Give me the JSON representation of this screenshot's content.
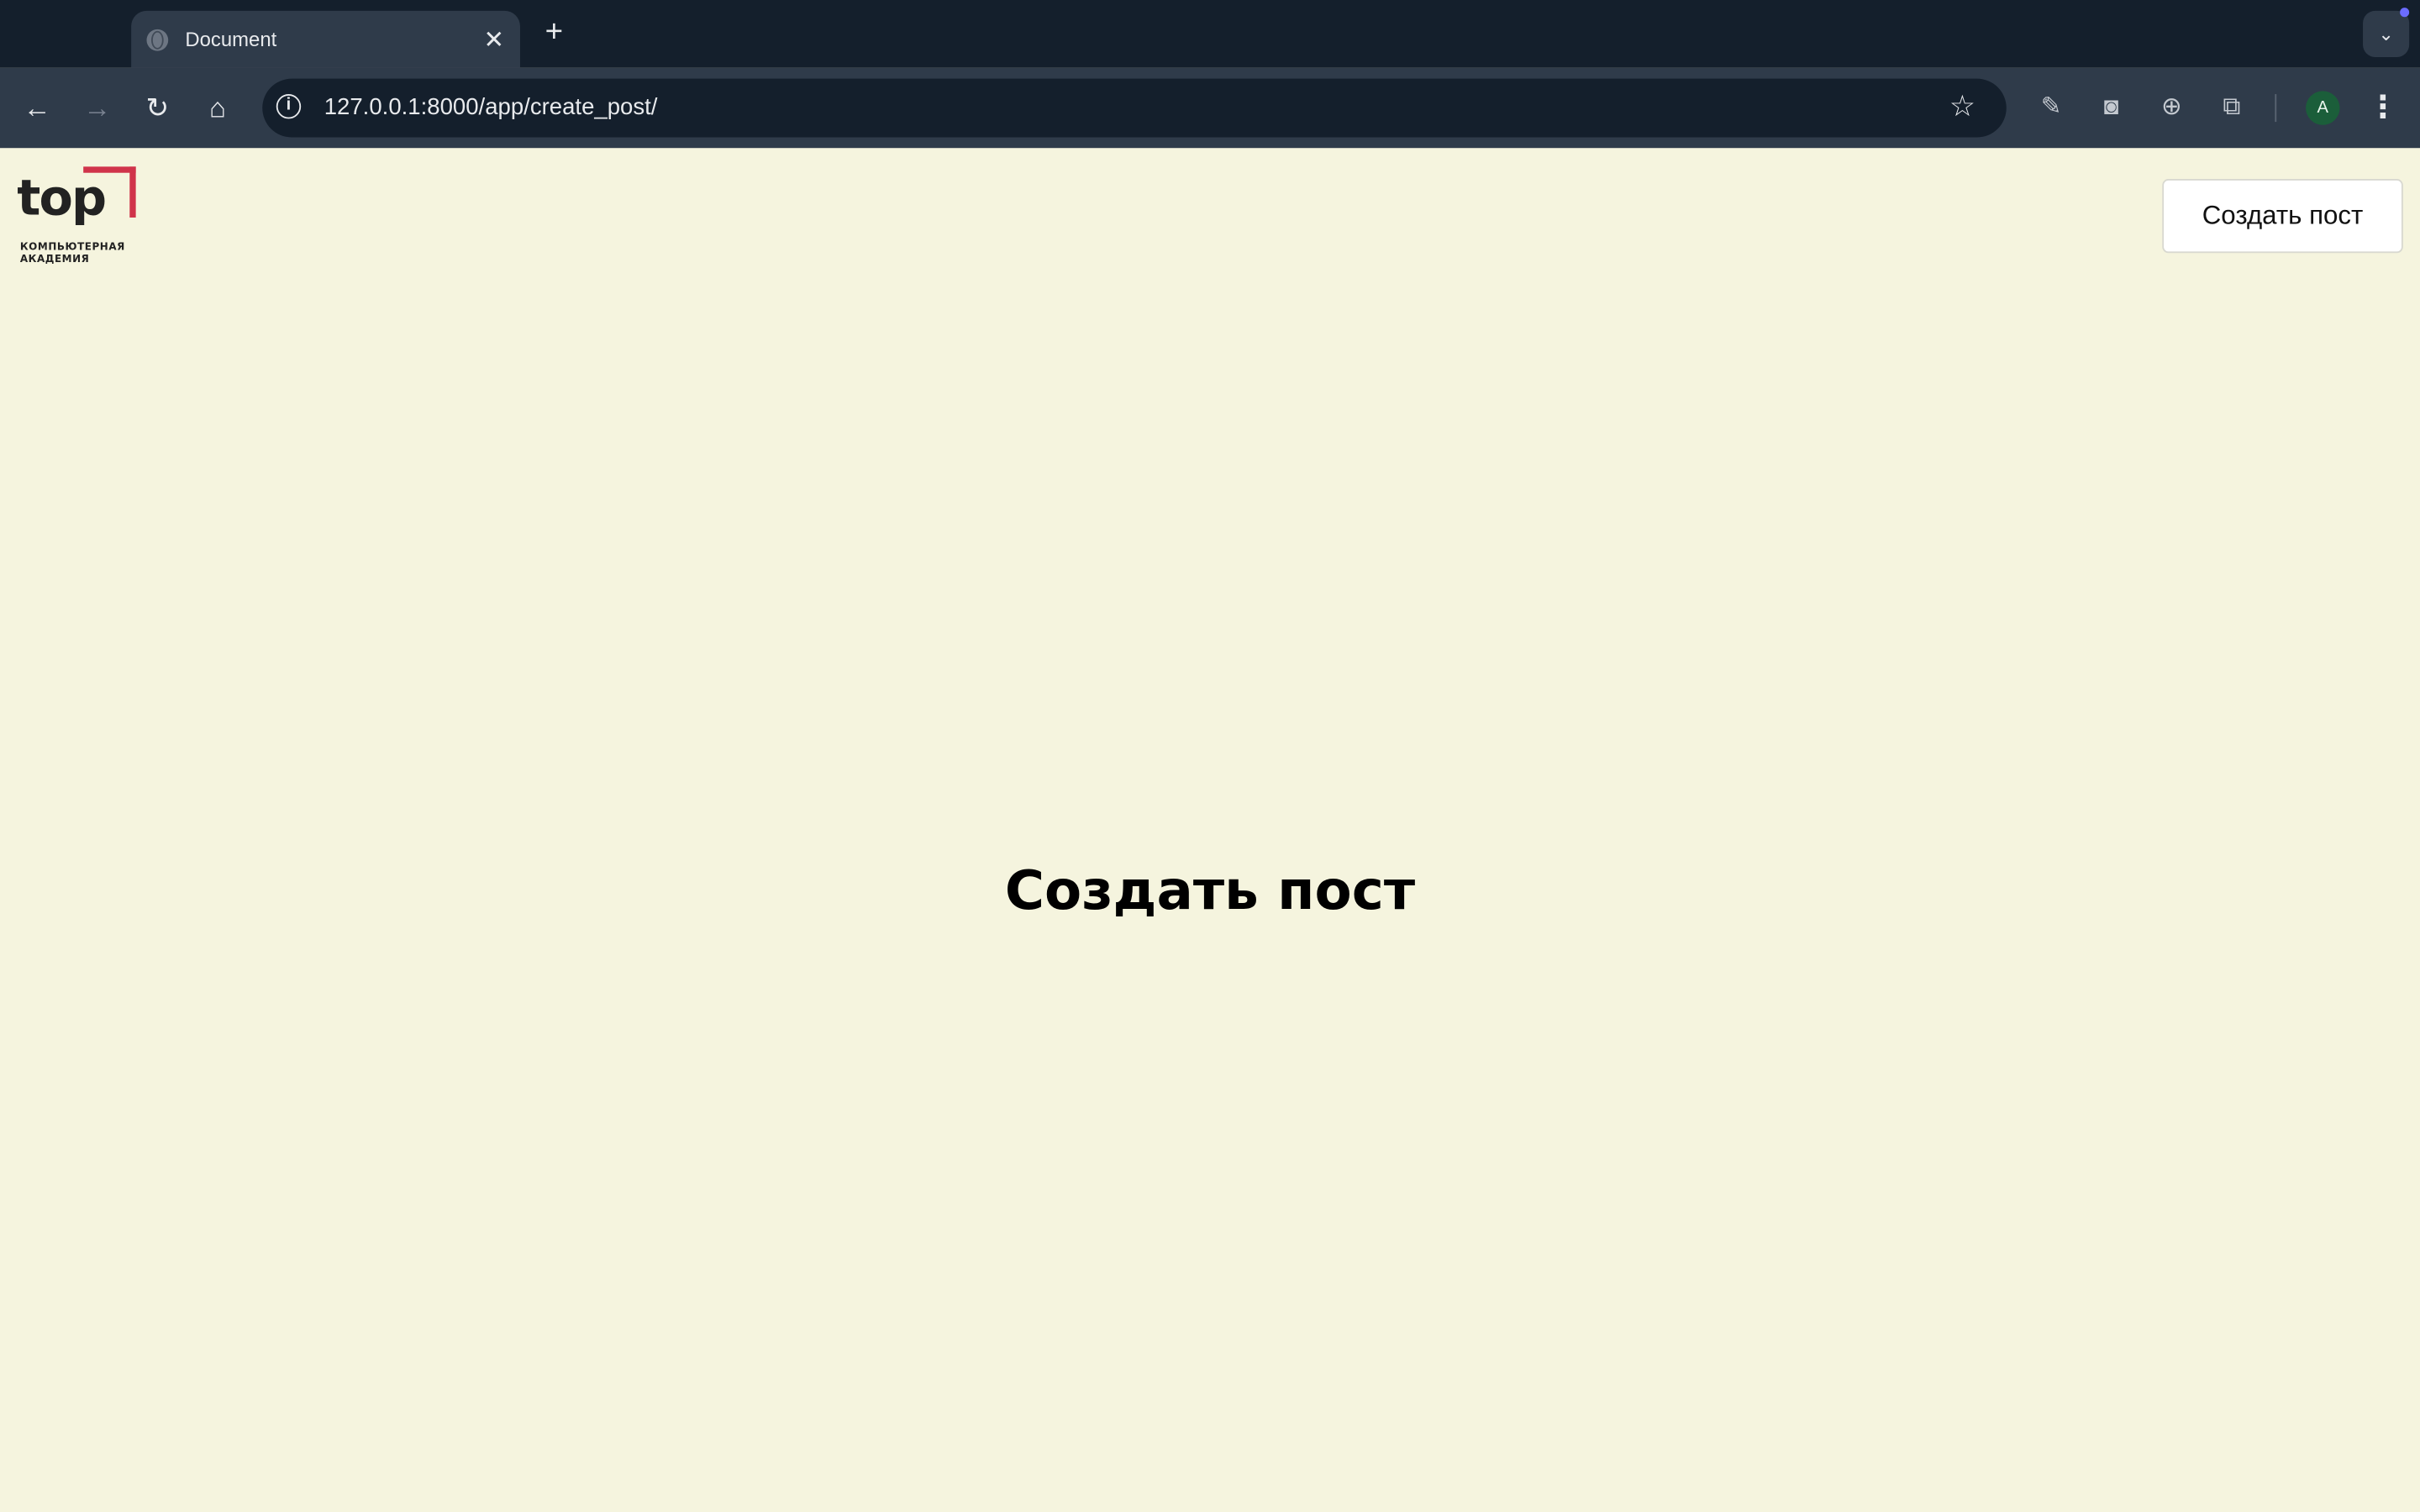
{
  "browser": {
    "tab_title": "Document",
    "tab_close": "✕",
    "new_tab": "+",
    "url": "127.0.0.1:8000/app/create_post/",
    "profile_initial": "A"
  },
  "page": {
    "logo": {
      "word": "top",
      "subtitle": "КОМПЬЮТЕРНАЯ\nАКАДЕМИЯ"
    },
    "header_button": "Создать пост",
    "heading": "Создать пост"
  },
  "colors": {
    "background": "#f5f4de",
    "logo_accent": "#d0334a",
    "chrome_dark": "#141f2c",
    "chrome_toolbar": "#2f3b4a"
  },
  "icons": [
    "globe-icon",
    "close-icon",
    "plus-icon",
    "chevron-down-icon",
    "back-icon",
    "forward-icon",
    "reload-icon",
    "home-icon",
    "info-icon",
    "star-icon",
    "eyedropper-icon",
    "camera-icon",
    "translate-icon",
    "extensions-icon",
    "more-icon"
  ]
}
